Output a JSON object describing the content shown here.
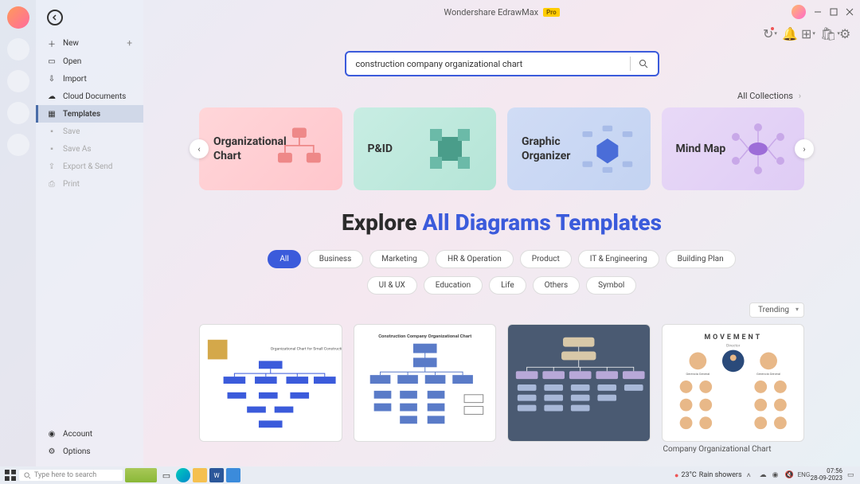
{
  "app_title": "Wondershare EdrawMax",
  "pro_badge": "Pro",
  "sidebar": {
    "items": [
      {
        "icon": "plus",
        "label": "New",
        "has_plus": true
      },
      {
        "icon": "folder",
        "label": "Open"
      },
      {
        "icon": "import",
        "label": "Import"
      },
      {
        "icon": "cloud",
        "label": "Cloud Documents"
      },
      {
        "icon": "templates",
        "label": "Templates",
        "active": true
      },
      {
        "icon": "save",
        "label": "Save",
        "disabled": true
      },
      {
        "icon": "saveas",
        "label": "Save As",
        "disabled": true
      },
      {
        "icon": "export",
        "label": "Export & Send",
        "disabled": true
      },
      {
        "icon": "print",
        "label": "Print",
        "disabled": true
      }
    ],
    "footer": [
      {
        "icon": "account",
        "label": "Account"
      },
      {
        "icon": "options",
        "label": "Options"
      }
    ]
  },
  "search": {
    "value": "construction company organizational chart"
  },
  "all_collections": "All Collections",
  "carousel": [
    {
      "label": "Organizational Chart",
      "theme": "pink"
    },
    {
      "label": "P&ID",
      "theme": "teal"
    },
    {
      "label": "Graphic Organizer",
      "theme": "blue"
    },
    {
      "label": "Mind Map",
      "theme": "purple"
    }
  ],
  "explore": {
    "prefix": "Explore",
    "accent": "All Diagrams Templates"
  },
  "categories_row1": [
    "All",
    "Business",
    "Marketing",
    "HR & Operation",
    "Product",
    "IT & Engineering",
    "Building Plan"
  ],
  "categories_row2": [
    "UI & UX",
    "Education",
    "Life",
    "Others",
    "Symbol"
  ],
  "active_category": "All",
  "sort": "Trending",
  "templates": [
    {
      "title": "Organizational Chart for Small Construction Company"
    },
    {
      "title": "Construction Company Organizational Chart"
    },
    {
      "title": ""
    },
    {
      "title": "Company Organizational Chart"
    }
  ],
  "taskbar": {
    "search_placeholder": "Type here to search",
    "weather_temp": "23°C",
    "weather_text": "Rain showers",
    "time": "07:56",
    "date": "28-09-2023"
  }
}
